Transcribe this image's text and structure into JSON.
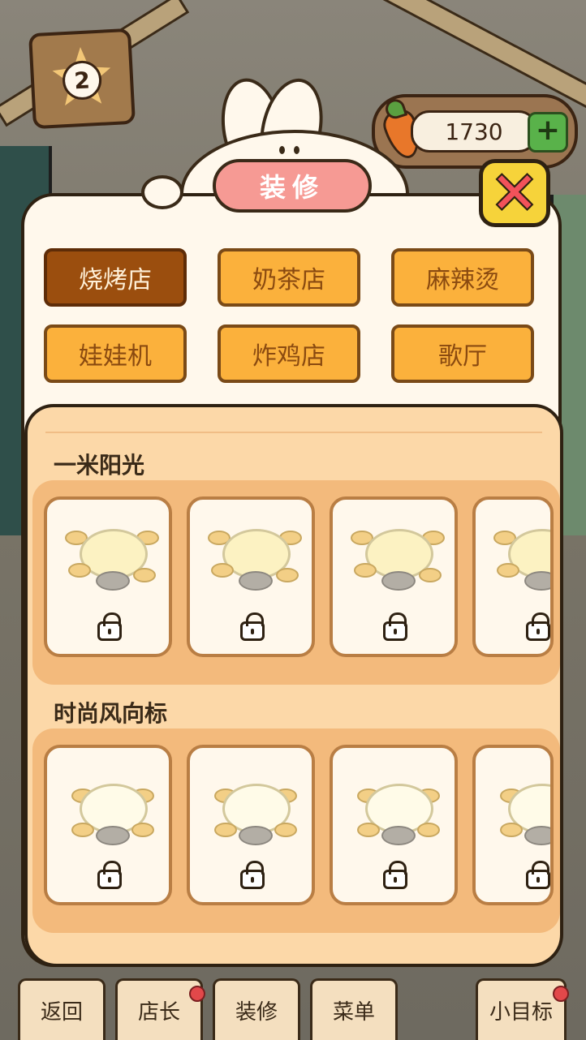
{
  "level": "2",
  "currency": {
    "amount": "1730",
    "add_label": "+"
  },
  "panel": {
    "title": "装修",
    "close_label": "✕",
    "categories": [
      {
        "label": "烧烤店",
        "selected": true
      },
      {
        "label": "奶茶店",
        "selected": false
      },
      {
        "label": "麻辣烫",
        "selected": false
      },
      {
        "label": "娃娃机",
        "selected": false
      },
      {
        "label": "炸鸡店",
        "selected": false
      },
      {
        "label": "歌厅",
        "selected": false
      }
    ],
    "sections": [
      {
        "title": "一米阳光",
        "item_count": 4,
        "locked": true
      },
      {
        "title": "时尚风向标",
        "item_count": 4,
        "locked": true
      }
    ]
  },
  "bottom_nav": [
    {
      "label": "返回",
      "badge": false
    },
    {
      "label": "店长",
      "badge": true
    },
    {
      "label": "装修",
      "badge": false
    },
    {
      "label": "菜单",
      "badge": false
    },
    {
      "label": "小目标",
      "badge": true
    }
  ],
  "colors": {
    "accent_orange": "#fbb13c",
    "selected_brown": "#9b4e0e",
    "title_pink": "#f69a94",
    "close_yellow": "#f6d33a",
    "close_red": "#f2525a"
  }
}
